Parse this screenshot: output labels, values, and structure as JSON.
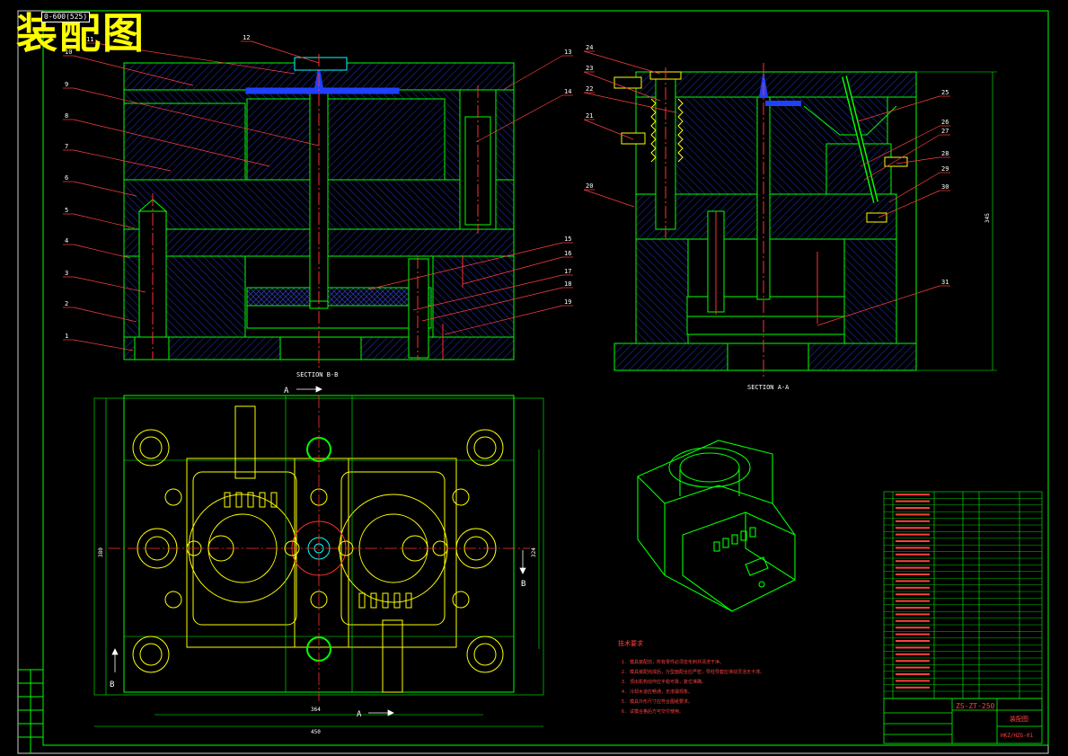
{
  "title": "装配图",
  "drawing_tag": "0-600(525)",
  "section_labels": {
    "bb": "SECTION B-B",
    "aa": "SECTION A-A"
  },
  "cut_marks": {
    "a": "A",
    "b": "B"
  },
  "dimensions": {
    "width_total": "450",
    "width_inner": "364",
    "height_left": "380",
    "height_right": "324",
    "height_side": "345"
  },
  "tech_title": "技术要求",
  "tech_notes": [
    "1. 模具装配前，所有零件必须去毛刺并清洗干净。",
    "2. 模具装配完成后，分型面配合应严密，导柱导套应滑动灵活无卡滞。",
    "3. 顶出机构动作应平稳可靠，复位准确。",
    "4. 冷却水道应畅通，无渗漏现象。",
    "5. 模具外形尺寸应符合图纸要求。",
    "6. 试模合格后方可交付使用。"
  ],
  "part_numbers": [
    "1",
    "2",
    "3",
    "4",
    "5",
    "6",
    "7",
    "8",
    "9",
    "10",
    "11",
    "12",
    "13",
    "14",
    "15",
    "16",
    "17",
    "18",
    "19",
    "20",
    "21",
    "22",
    "23",
    "24",
    "25",
    "26",
    "27",
    "28",
    "29",
    "30",
    "31"
  ],
  "title_block": {
    "drawing_no": "ZS-ZT-250",
    "name": "装配图",
    "code": "HKZ/HZG-01"
  },
  "colors": {
    "background": "#000000",
    "frame": "#00ff00",
    "hatch": "#1c2ea8",
    "centerline": "#ff3030",
    "leader": "#ff4040",
    "yellow": "#ffff00",
    "cyan": "#00ffff",
    "white": "#ffffff",
    "blue": "#2040ff"
  }
}
